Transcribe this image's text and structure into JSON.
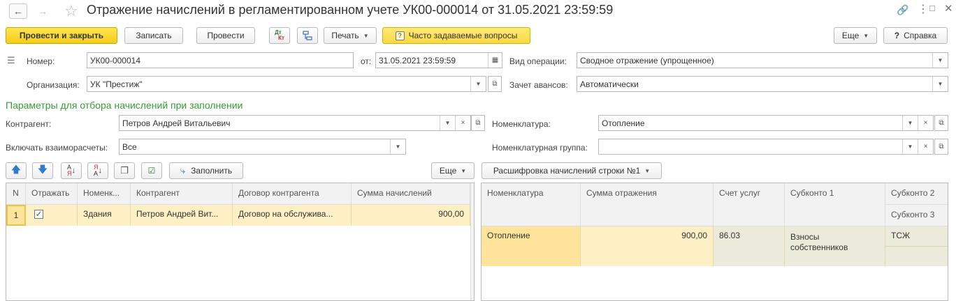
{
  "window": {
    "title": "Отражение начислений в регламентированном учете УК00-000014 от 31.05.2021 23:59:59"
  },
  "toolbar": {
    "post_close": "Провести и закрыть",
    "save": "Записать",
    "post": "Провести",
    "dtkt_top": "Дт",
    "dtkt_bottom": "Кт",
    "print": "Печать",
    "faq": "Часто задаваемые вопросы",
    "more": "Еще",
    "help": "Справка"
  },
  "header": {
    "number_label": "Номер:",
    "number_value": "УК00-000014",
    "date_label": "от:",
    "date_value": "31.05.2021 23:59:59",
    "operation_label": "Вид операции:",
    "operation_value": "Сводное отражение (упрощенное)",
    "org_label": "Организация:",
    "org_value": "УК \"Престиж\"",
    "advance_label": "Зачет авансов:",
    "advance_value": "Автоматически"
  },
  "filters": {
    "section_title": "Параметры для отбора начислений при заполнении",
    "contractor_label": "Контрагент:",
    "contractor_value": "Петров Андрей Витальевич",
    "mutual_label": "Включать взаиморасчеты:",
    "mutual_value": "Все",
    "nomenclature_label": "Номенклатура:",
    "nomenclature_value": "Отопление",
    "nomgroup_label": "Номенклатурная группа:",
    "nomgroup_value": ""
  },
  "left_toolbar": {
    "fill": "Заполнить",
    "more": "Еще"
  },
  "left_table": {
    "columns": [
      "N",
      "Отражать",
      "Номенк...",
      "Контрагент",
      "Договор контрагента",
      "Сумма начислений"
    ],
    "rows": [
      {
        "n": "1",
        "reflect": true,
        "nomenclature": "Здания",
        "contractor": "Петров Андрей Вит...",
        "contract": "Договор на обслужива...",
        "sum": "900,00"
      }
    ]
  },
  "right_toolbar": {
    "breakdown": "Расшифровка начислений строки №1"
  },
  "right_table": {
    "columns": [
      "Номенклатура",
      "Сумма отражения",
      "Счет услуг",
      "Субконто 1",
      "Субконто 2",
      "Субконто 3"
    ],
    "rows": [
      {
        "nomenclature": "Отопление",
        "sum": "900,00",
        "account": "86.03",
        "subconto1": "Взносы собственников",
        "subconto2": "ТСЖ",
        "subconto3": ""
      }
    ]
  },
  "colors": {
    "accent_yellow": "#f4cd18",
    "section_green": "#3a9b3a",
    "row_highlight": "#fdf0c4",
    "cell_selected": "#fde49a",
    "cell_readonly": "#ebeadb"
  }
}
